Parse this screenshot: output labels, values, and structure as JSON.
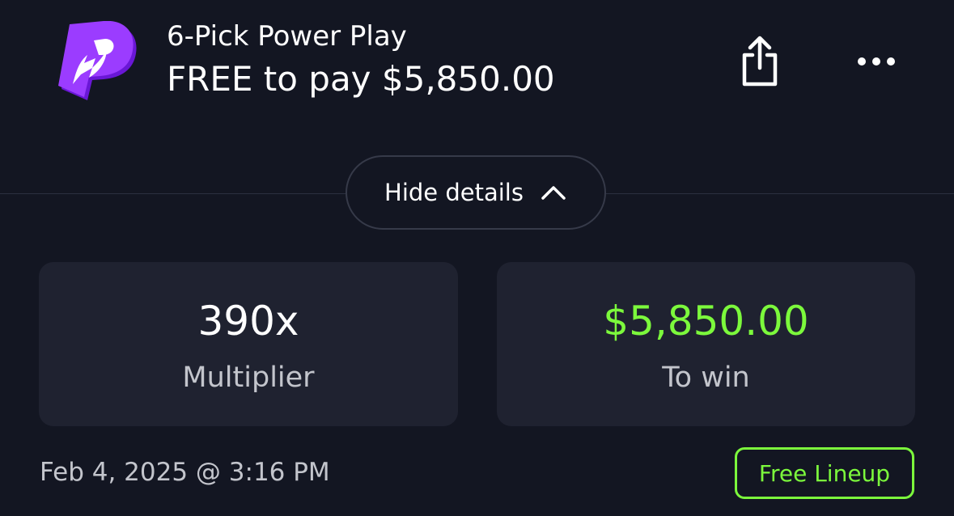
{
  "header": {
    "logo_icon": "power-play-p-logo",
    "subtitle": "6-Pick Power Play",
    "title": "FREE to pay $5,850.00",
    "share_icon": "share-icon",
    "more_icon": "more-dots-icon"
  },
  "details_toggle": {
    "label": "Hide details",
    "icon": "chevron-up-icon"
  },
  "stats": {
    "multiplier": {
      "value": "390x",
      "caption": "Multiplier"
    },
    "to_win": {
      "value": "$5,850.00",
      "caption": "To win"
    }
  },
  "footer": {
    "date": "Feb 4, 2025 @ 3:16 PM",
    "badge": "Free Lineup"
  },
  "colors": {
    "background": "#131622",
    "card": "#1f2230",
    "accent_green": "#7cf93c",
    "logo_purple": "#8b2cf5"
  }
}
